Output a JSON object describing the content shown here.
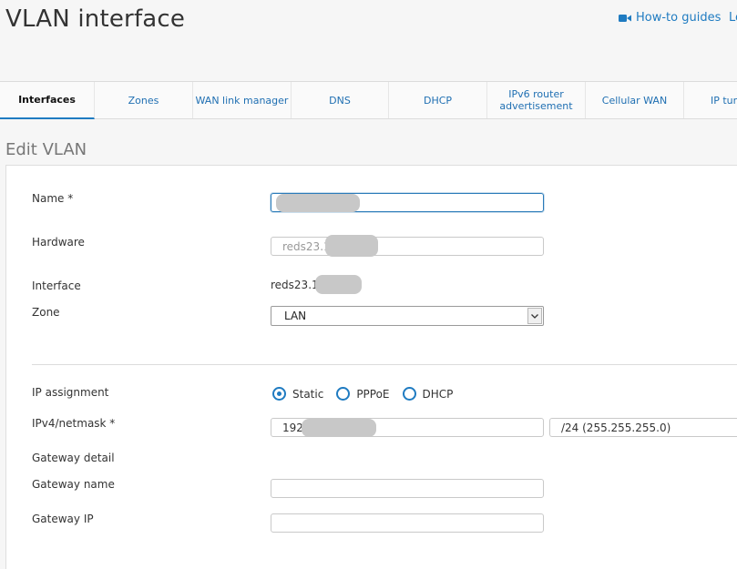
{
  "header": {
    "title": "VLAN interface",
    "howto_label": "How-to guides",
    "cut_link": "Lo"
  },
  "tabs": [
    {
      "label": "Interfaces",
      "active": true
    },
    {
      "label": "Zones"
    },
    {
      "label": "WAN link manager"
    },
    {
      "label": "DNS"
    },
    {
      "label": "DHCP"
    },
    {
      "label": "IPv6 router advertisement"
    },
    {
      "label": "Cellular WAN"
    },
    {
      "label": "IP tun"
    }
  ],
  "form": {
    "section_title": "Edit VLAN",
    "name_label": "Name *",
    "name_value": "",
    "hardware_label": "Hardware",
    "hardware_value": "reds23.1",
    "interface_label": "Interface",
    "interface_value": "reds23.1",
    "zone_label": "Zone",
    "zone_value": "LAN",
    "ip_assignment_label": "IP assignment",
    "ip_options": [
      "Static",
      "PPPoE",
      "DHCP"
    ],
    "ip_selected": "Static",
    "ipv4_label": "IPv4/netmask *",
    "ipv4_value": "192",
    "netmask_value": "/24 (255.255.255.0)",
    "gateway_detail_label": "Gateway detail",
    "gateway_name_label": "Gateway name",
    "gateway_name_value": "",
    "gateway_ip_label": "Gateway IP",
    "gateway_ip_value": ""
  },
  "colors": {
    "accent": "#1f7bc1",
    "redaction": "#c8c8c8"
  },
  "icons": {
    "howto": "video-camera-icon",
    "select_arrow": "chevron-down-icon"
  }
}
